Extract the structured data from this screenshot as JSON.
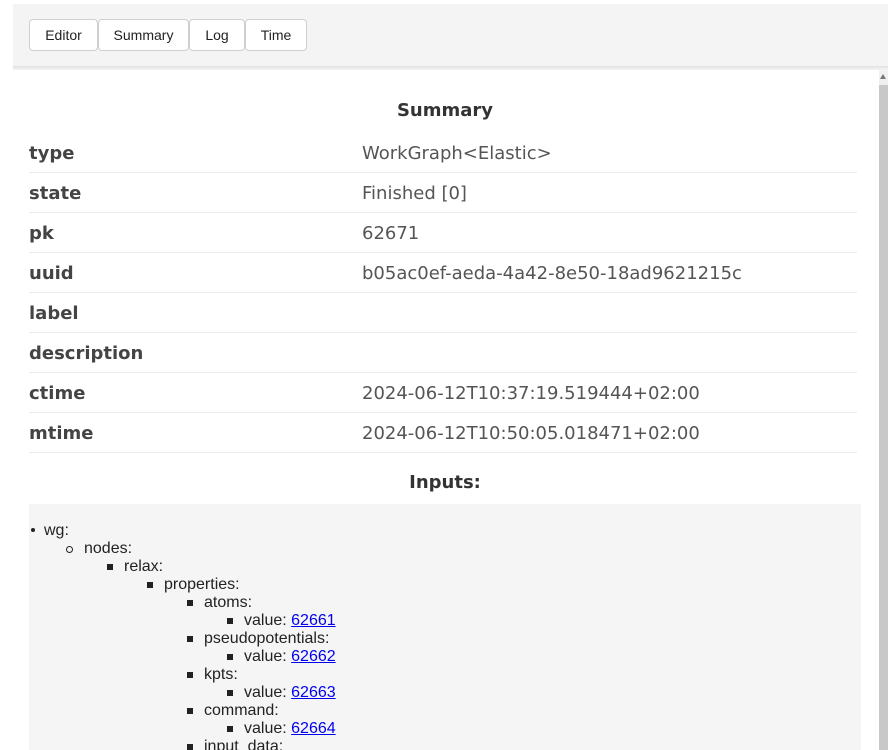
{
  "tabs": [
    {
      "label": "Editor"
    },
    {
      "label": "Summary"
    },
    {
      "label": "Log"
    },
    {
      "label": "Time"
    }
  ],
  "summary": {
    "title": "Summary",
    "rows": [
      {
        "key": "type",
        "value": "WorkGraph<Elastic>"
      },
      {
        "key": "state",
        "value": "Finished [0]"
      },
      {
        "key": "pk",
        "value": "62671"
      },
      {
        "key": "uuid",
        "value": "b05ac0ef-aeda-4a42-8e50-18ad9621215c"
      },
      {
        "key": "label",
        "value": ""
      },
      {
        "key": "description",
        "value": ""
      },
      {
        "key": "ctime",
        "value": "2024-06-12T10:37:19.519444+02:00"
      },
      {
        "key": "mtime",
        "value": "2024-06-12T10:50:05.018471+02:00"
      }
    ]
  },
  "inputs": {
    "title": "Inputs:",
    "tree": {
      "wg": "wg:",
      "nodes": "nodes:",
      "relax": "relax:",
      "properties": "properties:",
      "atoms": "atoms:",
      "atoms_value_label": "value: ",
      "atoms_value": "62661",
      "pseudopotentials": "pseudopotentials:",
      "pseudopotentials_value_label": "value: ",
      "pseudopotentials_value": "62662",
      "kpts": "kpts:",
      "kpts_value_label": "value: ",
      "kpts_value": "62663",
      "command": "command:",
      "command_value_label": "value: ",
      "command_value": "62664",
      "input_data": "input_data:"
    }
  }
}
